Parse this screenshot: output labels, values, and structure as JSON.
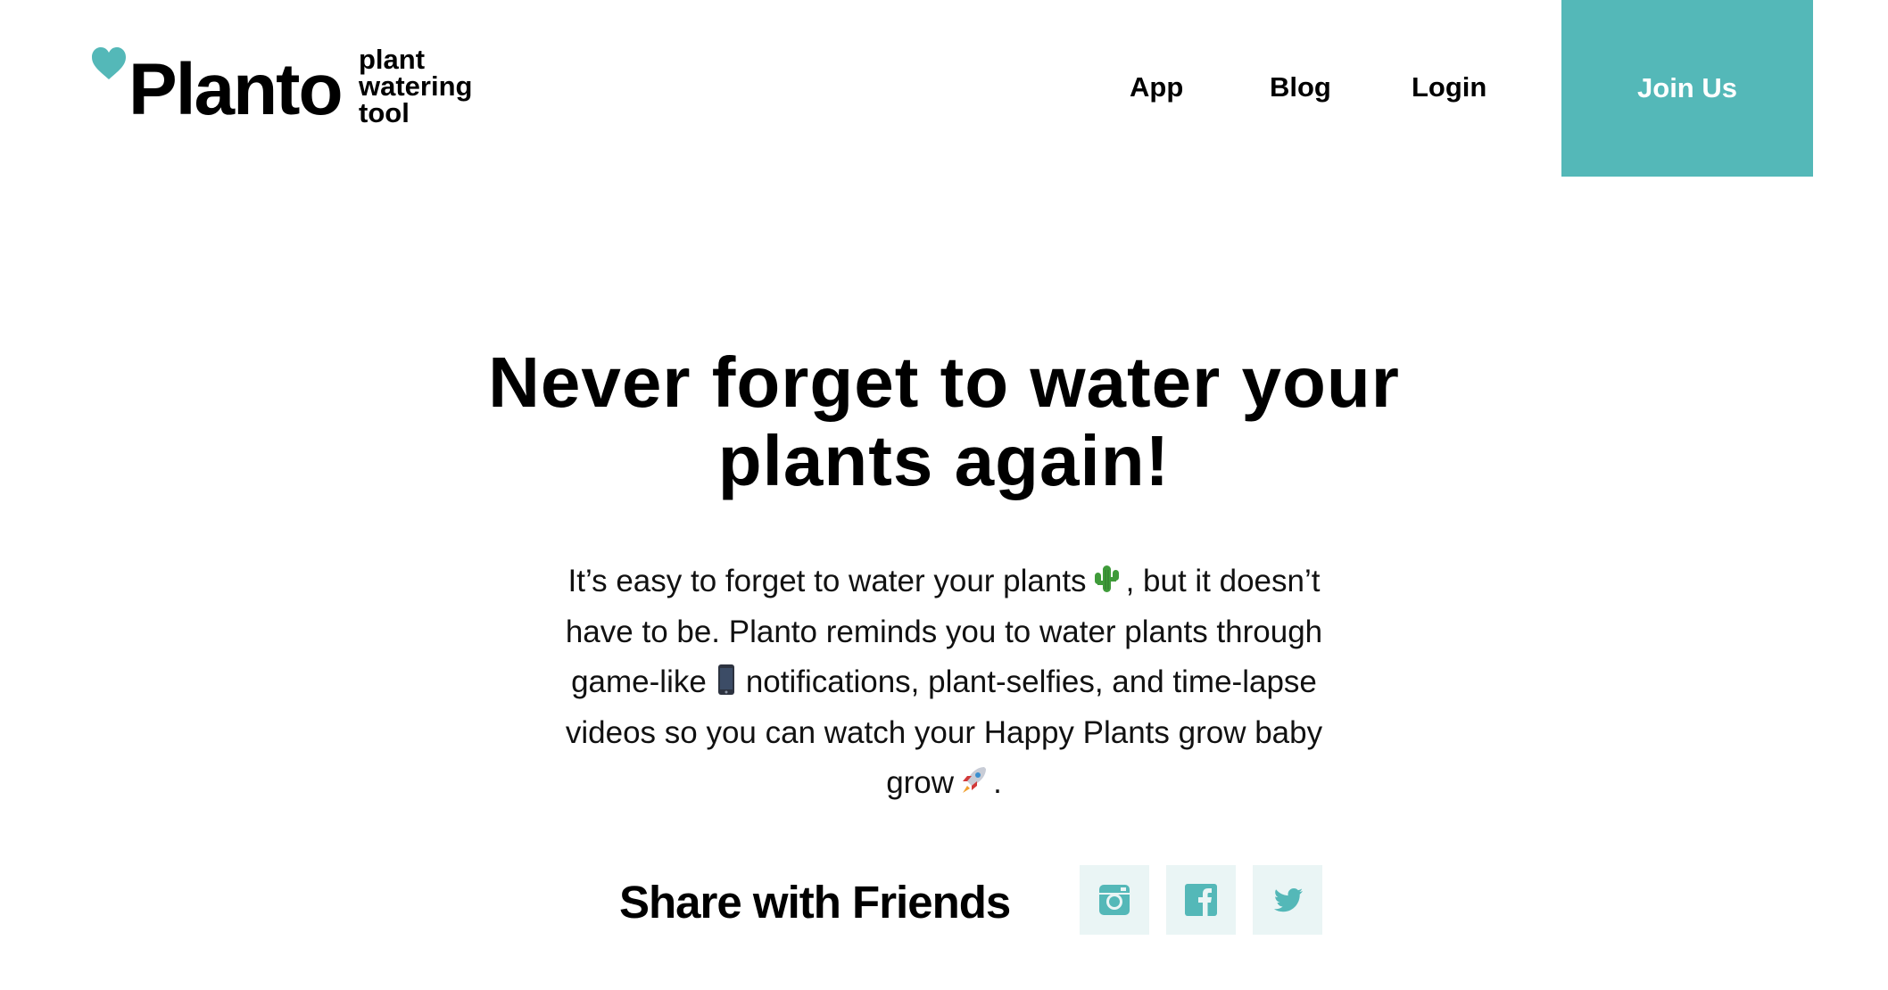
{
  "brand": {
    "name": "Planto",
    "tagline": [
      "plant",
      "watering",
      "tool"
    ],
    "accent_color": "#54b8b8"
  },
  "nav": {
    "links": [
      {
        "label": "App"
      },
      {
        "label": "Blog"
      },
      {
        "label": "Login"
      }
    ],
    "cta_label": "Join Us"
  },
  "hero": {
    "title_line1": "Never forget to water your",
    "title_line2": "plants again!",
    "body": {
      "part1": "It’s easy to forget to water your plants",
      "emoji1": "cactus",
      "part2": ", but it doesn’t have to be. Planto reminds you to water plants through game-like",
      "emoji2": "mobile-phone",
      "part3": "notifications, plant-selfies, and time-lapse videos so you can watch your Happy Plants grow baby grow",
      "emoji3": "rocket",
      "part4": "."
    }
  },
  "share": {
    "label": "Share with Friends",
    "icons": [
      "instagram-icon",
      "facebook-icon",
      "twitter-icon"
    ],
    "button_bg": "#eaf5f5"
  }
}
